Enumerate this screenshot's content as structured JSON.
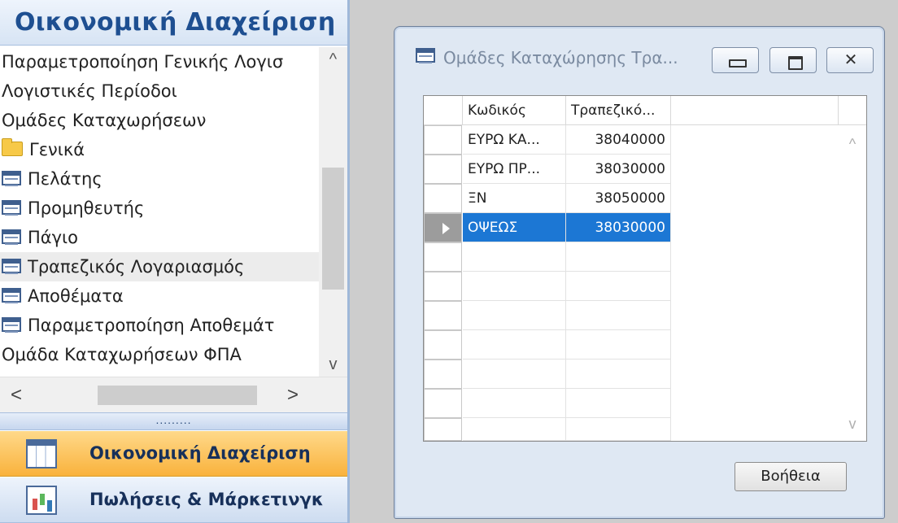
{
  "nav": {
    "title": "Οικονομική Διαχείριση",
    "tree_items": [
      {
        "label": "Παραμετροποίηση Γενικής Λογισ",
        "icon": "none"
      },
      {
        "label": "Λογιστικές Περίοδοι",
        "icon": "none"
      },
      {
        "label": "Ομάδες Καταχωρήσεων",
        "icon": "none"
      },
      {
        "label": "Γενικά",
        "icon": "folder-icon"
      },
      {
        "label": "Πελάτης",
        "icon": "form-icon"
      },
      {
        "label": "Προμηθευτής",
        "icon": "form-icon"
      },
      {
        "label": "Πάγιο",
        "icon": "form-icon"
      },
      {
        "label": "Τραπεζικός Λογαριασμός",
        "icon": "form-icon",
        "selected": true
      },
      {
        "label": "Αποθέματα",
        "icon": "form-icon"
      },
      {
        "label": "Παραμετροποίηση Αποθεμάτ",
        "icon": "form-icon"
      },
      {
        "label": "Ομάδα Καταχωρήσεων ΦΠΑ",
        "icon": "none"
      }
    ],
    "scroll_up": "^",
    "scroll_down": "v",
    "scroll_left": "<",
    "scroll_right": ">",
    "splitter": ".........",
    "buttons": [
      {
        "label": "Οικονομική Διαχείριση",
        "icon": "grid-icon",
        "active": true
      },
      {
        "label": "Πωλήσεις & Μάρκετινγκ",
        "icon": "chart-icon",
        "active": false
      }
    ]
  },
  "window": {
    "title": "Ομάδες Καταχώρησης Τρα...",
    "close_glyph": "✕",
    "columns": [
      "Κωδικός",
      "Τραπεζικό..."
    ],
    "rows": [
      {
        "code": "ΕΥΡΩ ΚΑ...",
        "account": "38040000"
      },
      {
        "code": "ΕΥΡΩ ΠΡ...",
        "account": "38030000"
      },
      {
        "code": "ΞΝ",
        "account": "38050000"
      },
      {
        "code": "ΟΨΕΩΣ",
        "account": "38030000",
        "selected": true
      }
    ],
    "grid_scroll_up": "^",
    "grid_scroll_down": "v",
    "help_button": "Βοήθεια"
  },
  "colors": {
    "nav_title": "#1e4f91",
    "selection": "#1c77d4",
    "active_nav_button": "#f9b23c"
  }
}
